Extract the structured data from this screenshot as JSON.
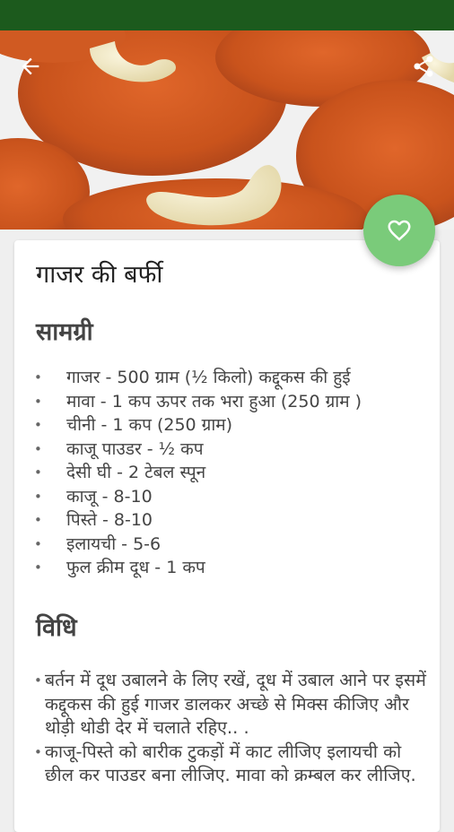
{
  "toolbar": {
    "back_icon": "arrow-back-icon",
    "share_icon": "share-icon"
  },
  "fab": {
    "icon": "heart-outline-icon",
    "color": "#7acb7a"
  },
  "recipe": {
    "title": "गाजर की बर्फी",
    "ingredients_heading": "सामग्री",
    "ingredients": [
      "गाजर - 500 ग्राम (½ किलो) कद्दूकस की हुई",
      "मावा - 1 कप ऊपर तक भरा हुआ (250 ग्राम )",
      "चीनी - 1 कप (250 ग्राम)",
      "काजू पाउडर - ½ कप",
      "देसी घी - 2 टेबल स्पून",
      "काजू - 8-10",
      "पिस्ते - 8-10",
      "इलायची - 5-6",
      "फुल क्रीम दूध - 1 कप"
    ],
    "method_heading": "विधि",
    "steps": [
      "बर्तन में दूध उबालने के लिए रखें, दूध में उबाल आने पर इसमें कद्दूकस की हुई गाजर डालकर अच्छे से मिक्स कीजिए और थोड़ी थोडी देर में चलाते रहिए.. .",
      "काजू-पिस्ते को बारीक टुकड़ों में काट लीजिए इलायची को छील कर पाउडर बना लीजिए. मावा को क्रम्बल कर लीजिए."
    ]
  },
  "colors": {
    "status_bar": "#1c5a1d",
    "accent": "#7acb7a"
  }
}
